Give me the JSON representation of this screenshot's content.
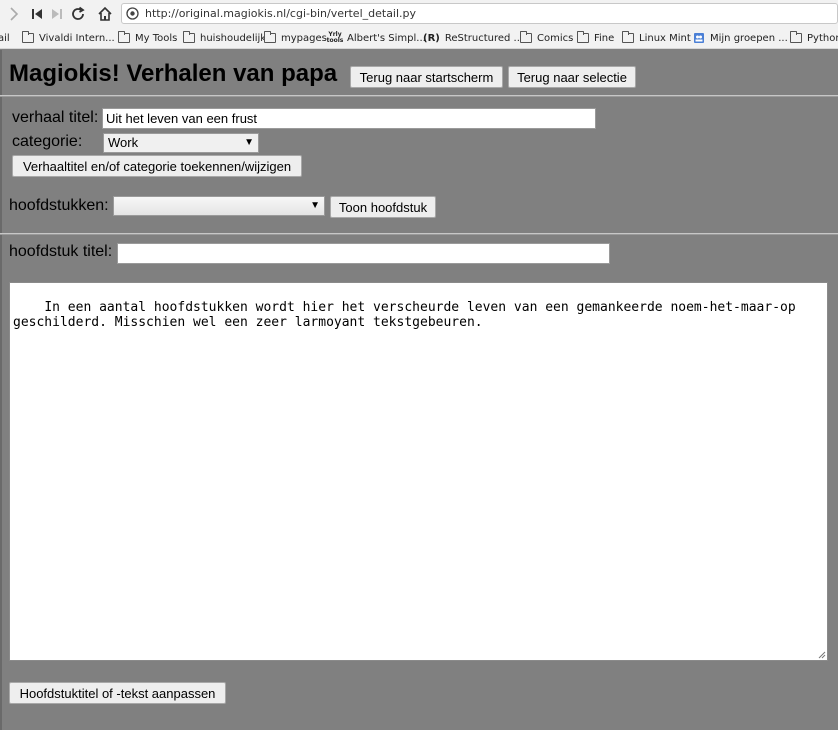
{
  "browser": {
    "url": "http://original.magiokis.nl/cgi-bin/vertel_detail.py",
    "bookmarks": [
      {
        "label": "ail",
        "icon": "mail-icon"
      },
      {
        "label": "Vivaldi Intern...",
        "icon": "folder-icon"
      },
      {
        "label": "My Tools",
        "icon": "folder-icon"
      },
      {
        "label": "huishoudelijk",
        "icon": "folder-icon"
      },
      {
        "label": "mypages",
        "icon": "folder-icon"
      },
      {
        "label": "Albert's Simpl...",
        "icon": "site-icon"
      },
      {
        "label": "ReStructured ...",
        "icon": "rst-icon"
      },
      {
        "label": "Comics",
        "icon": "folder-icon"
      },
      {
        "label": "Fine",
        "icon": "folder-icon"
      },
      {
        "label": "Linux Mint",
        "icon": "folder-icon"
      },
      {
        "label": "Mijn groepen ...",
        "icon": "groups-icon"
      },
      {
        "label": "Python",
        "icon": "folder-icon"
      }
    ]
  },
  "page": {
    "title": "Magiokis! Verhalen van papa",
    "btn_home": "Terug naar startscherm",
    "btn_selection": "Terug naar selectie",
    "story_title_label": "verhaal titel:",
    "story_title_value": "Uit het leven van een frust",
    "category_label": "categorie:",
    "category_value": "Work",
    "btn_assign": "Verhaaltitel en/of categorie toekennen/wijzigen",
    "chapters_label": "hoofdstukken:",
    "chapters_value": "",
    "btn_show_chapter": "Toon hoofdstuk",
    "chapter_title_label": "hoofdstuk titel:",
    "chapter_title_value": "",
    "chapter_text": "In een aantal hoofdstukken wordt hier het verscheurde leven van een gemankeerde noem-het-maar-op\ngeschilderd. Misschien wel een zeer larmoyant tekstgebeuren.",
    "btn_update": "Hoofdstuktitel of -tekst aanpassen"
  },
  "colors": {
    "page_background": "#808080",
    "chrome_background": "#f2f2f2"
  }
}
